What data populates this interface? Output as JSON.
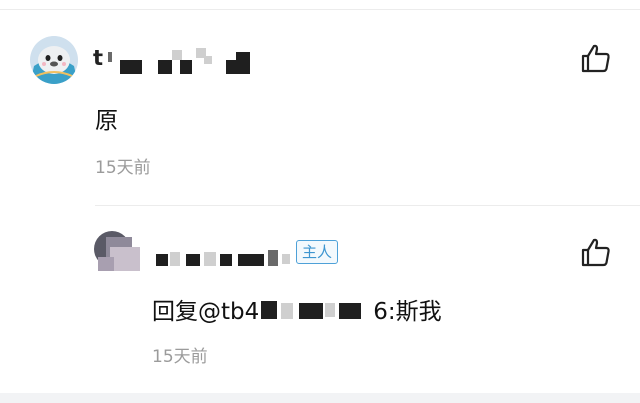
{
  "comments": [
    {
      "username_visible": "t",
      "text": "原",
      "timestamp": "15天前"
    }
  ],
  "reply": {
    "host_badge": "主人",
    "text_prefix": "回复@tb4",
    "text_suffix": "6:斯我",
    "timestamp": "15天前"
  },
  "icons": {
    "like": "thumbs-up-outline-icon",
    "avatar_main": "seal-cartoon-avatar",
    "avatar_sub": "blurred-avatar"
  },
  "colors": {
    "badge": "#3d95d0",
    "timestamp": "#9b9b9b",
    "divider": "#ececec"
  }
}
